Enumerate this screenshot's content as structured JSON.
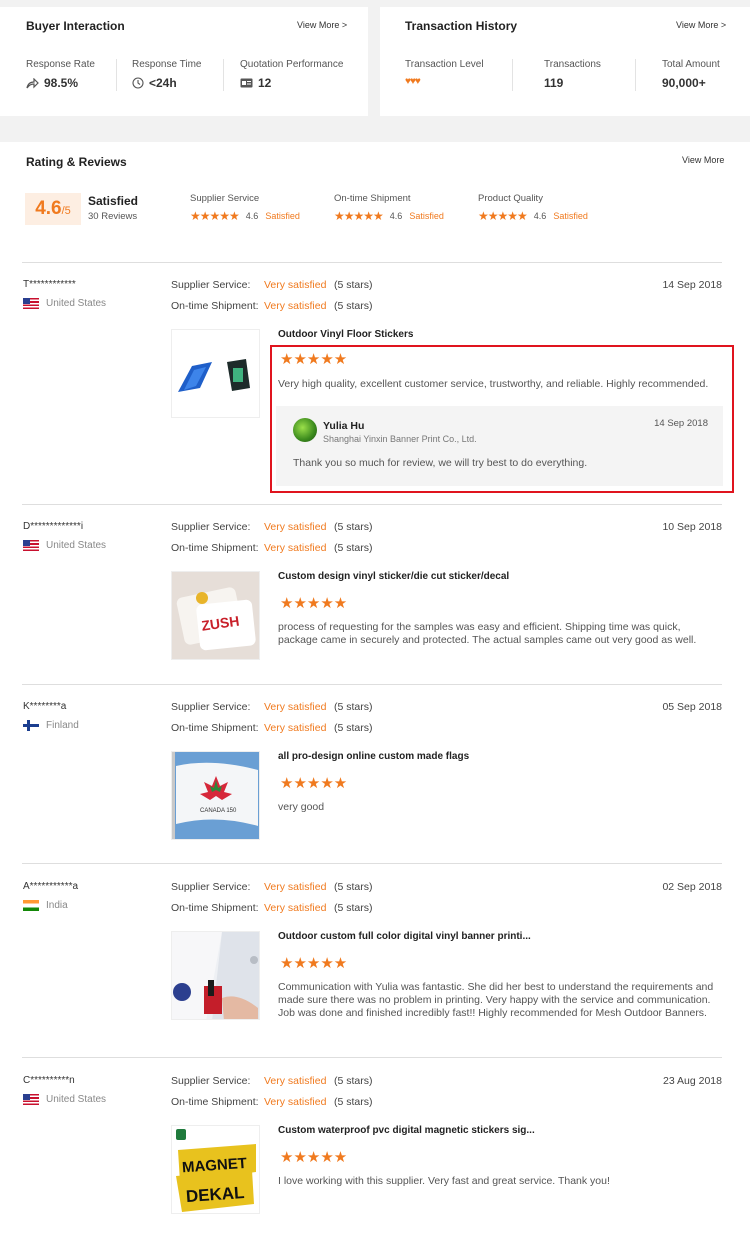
{
  "buyer_interaction": {
    "title": "Buyer Interaction",
    "view_more": "View More >",
    "stats": [
      {
        "label": "Response Rate",
        "value": "98.5%",
        "icon": "share-arrow-icon"
      },
      {
        "label": "Response Time",
        "value": "<24h",
        "icon": "clock-icon"
      },
      {
        "label": "Quotation Performance",
        "value": "12",
        "icon": "quotation-icon"
      }
    ]
  },
  "transaction_history": {
    "title": "Transaction History",
    "view_more": "View More >",
    "stats": [
      {
        "label": "Transaction Level",
        "value": "♥♥♥"
      },
      {
        "label": "Transactions",
        "value": "119"
      },
      {
        "label": "Total Amount",
        "value": "90,000+"
      }
    ]
  },
  "rating_reviews": {
    "title": "Rating & Reviews",
    "view_more": "View More",
    "score": "4.6",
    "score_suffix": "/5",
    "summary": "Satisfied",
    "count": "30 Reviews",
    "categories": [
      {
        "label": "Supplier Service",
        "stars": "★★★★★",
        "rating": "4.6",
        "status": "Satisfied"
      },
      {
        "label": "On-time Shipment",
        "stars": "★★★★★",
        "rating": "4.6",
        "status": "Satisfied"
      },
      {
        "label": "Product Quality",
        "stars": "★★★★★",
        "rating": "4.6",
        "status": "Satisfied"
      }
    ]
  },
  "labels": {
    "supplier_service": "Supplier Service:",
    "ontime_shipment": "On-time Shipment:",
    "very_satisfied": "Very satisfied",
    "five_stars": "(5 stars)",
    "stars5": "★★★★★"
  },
  "reviews": [
    {
      "buyer": "T************",
      "country": "United States",
      "date": "14 Sep 2018",
      "product": "Outdoor Vinyl Floor Stickers",
      "text": "Very high quality, excellent customer service, trustworthy, and reliable. Highly recommended.",
      "reply": {
        "name": "Yulia Hu",
        "company": "Shanghai Yinxin Banner Print Co., Ltd.",
        "date": "14 Sep 2018",
        "text": "Thank you so much for review, we will try best to do everything."
      }
    },
    {
      "buyer": "D*************i",
      "country": "United States",
      "date": "10 Sep 2018",
      "product": "Custom design vinyl sticker/die cut sticker/decal",
      "text": "process of requesting for the samples was easy and efficient. Shipping time was quick, package came in securely and protected. The actual samples came out very good as well."
    },
    {
      "buyer": "K********a",
      "country": "Finland",
      "date": "05 Sep 2018",
      "product": "all pro-design online custom made flags",
      "text": "very good"
    },
    {
      "buyer": "A***********a",
      "country": "India",
      "date": "02 Sep 2018",
      "product": "Outdoor custom full color digital vinyl banner printi...",
      "text": "Communication with Yulia was fantastic. She did her best to understand the requirements and made sure there was no problem in printing. Very happy with the service and communication. Job was done and finished incredibly fast!! Highly recommended for Mesh Outdoor Banners."
    },
    {
      "buyer": "C**********n",
      "country": "United States",
      "date": "23 Aug 2018",
      "product": "Custom waterproof pvc digital magnetic stickers sig...",
      "text": "I love working with this supplier. Very fast and great service. Thank you!"
    }
  ],
  "thumb_texts": {
    "sticker_word": "ZUSH",
    "flag_caption": "CANADA 150",
    "magnet_word1": "MAGNET",
    "magnet_word2": "DEKAL"
  },
  "colors": {
    "accent": "#f07a1f",
    "highlight": "#e0141e"
  }
}
